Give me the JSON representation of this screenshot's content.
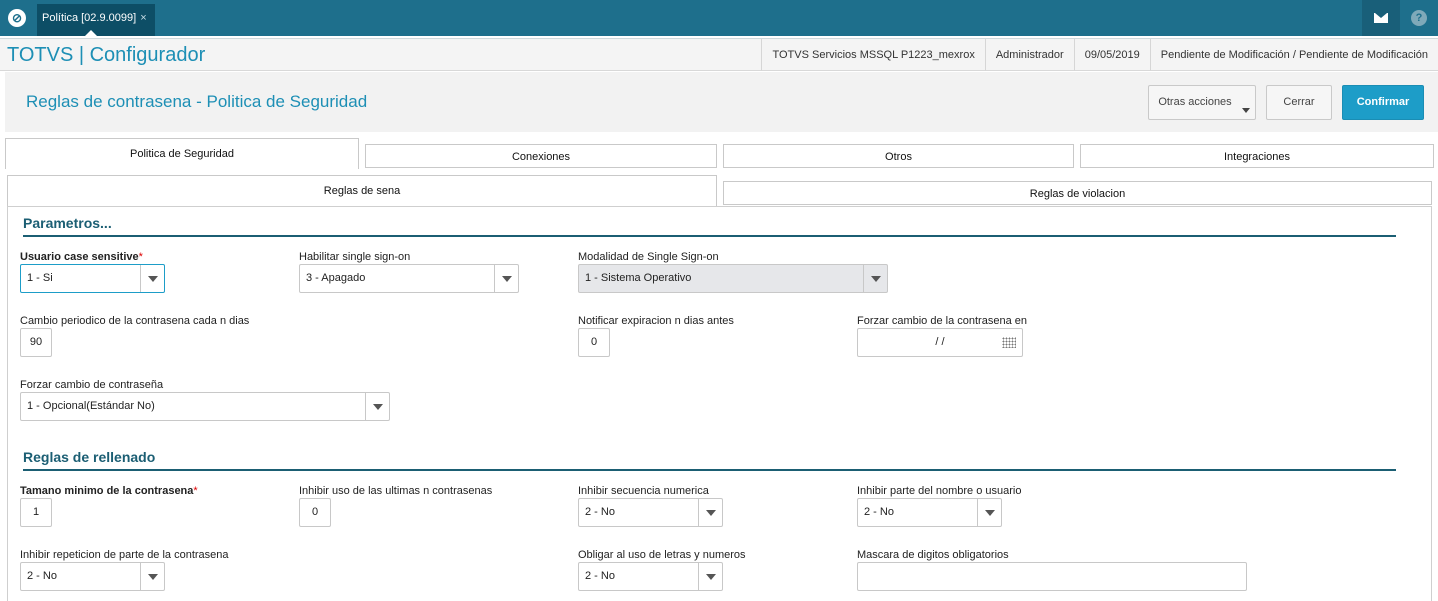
{
  "top_tab": {
    "label": "Política [02.9.0099]",
    "close": "×"
  },
  "icons": {
    "logo": "totvs-logo-icon",
    "mail": "mail-icon",
    "help": "help-icon"
  },
  "app": {
    "title": "TOTVS | Configurador",
    "environment": "TOTVS Servicios MSSQL P1223_mexrox",
    "user": "Administrador",
    "date": "09/05/2019",
    "status": "Pendiente de Modificación / Pendiente de Modificación"
  },
  "page": {
    "title": "Reglas de contrasena - Politica de Seguridad"
  },
  "buttons": {
    "otras": "Otras acciones",
    "cerrar": "Cerrar",
    "confirmar": "Confirmar"
  },
  "tabs": {
    "politica": "Politica de Seguridad",
    "conexiones": "Conexiones",
    "otros": "Otros",
    "integraciones": "Integraciones"
  },
  "subtabs": {
    "sena": "Reglas de sena",
    "violacion": "Reglas de violacion"
  },
  "sections": {
    "parametros": "Parametros...",
    "rellenado": "Reglas de rellenado"
  },
  "fields": {
    "usuario_case": {
      "label": "Usuario case sensitive",
      "required": "*",
      "value": "1 - Si"
    },
    "single_signon": {
      "label": "Habilitar single sign-on",
      "value": "3 - Apagado"
    },
    "modalidad_sso": {
      "label": "Modalidad de Single Sign-on",
      "value": "1 - Sistema Operativo"
    },
    "cambio_periodico": {
      "label": "Cambio periodico de la contrasena cada n dias",
      "value": "90"
    },
    "notificar": {
      "label": "Notificar expiracion n dias antes",
      "value": "0"
    },
    "forzar_en": {
      "label": "Forzar cambio de la contrasena en",
      "value": "/ /"
    },
    "forzar_cambio": {
      "label": "Forzar cambio de contraseña",
      "value": "1 - Opcional(Estándar No)"
    },
    "tamano_minimo": {
      "label": "Tamano minimo de la contrasena",
      "required": "*",
      "value": "1"
    },
    "inhibir_ultimas": {
      "label": "Inhibir uso de las ultimas n contrasenas",
      "value": "0"
    },
    "inhibir_secuencia": {
      "label": "Inhibir secuencia numerica",
      "value": "2 - No"
    },
    "inhibir_nombre": {
      "label": "Inhibir parte del nombre o usuario",
      "value": "2 - No"
    },
    "inhibir_repeticion": {
      "label": "Inhibir repeticion de parte de la contrasena",
      "value": "2 - No"
    },
    "obligar_letras": {
      "label": "Obligar al uso de letras y numeros",
      "value": "2 - No"
    },
    "mascara": {
      "label": "Mascara de digitos obligatorios",
      "value": ""
    }
  }
}
